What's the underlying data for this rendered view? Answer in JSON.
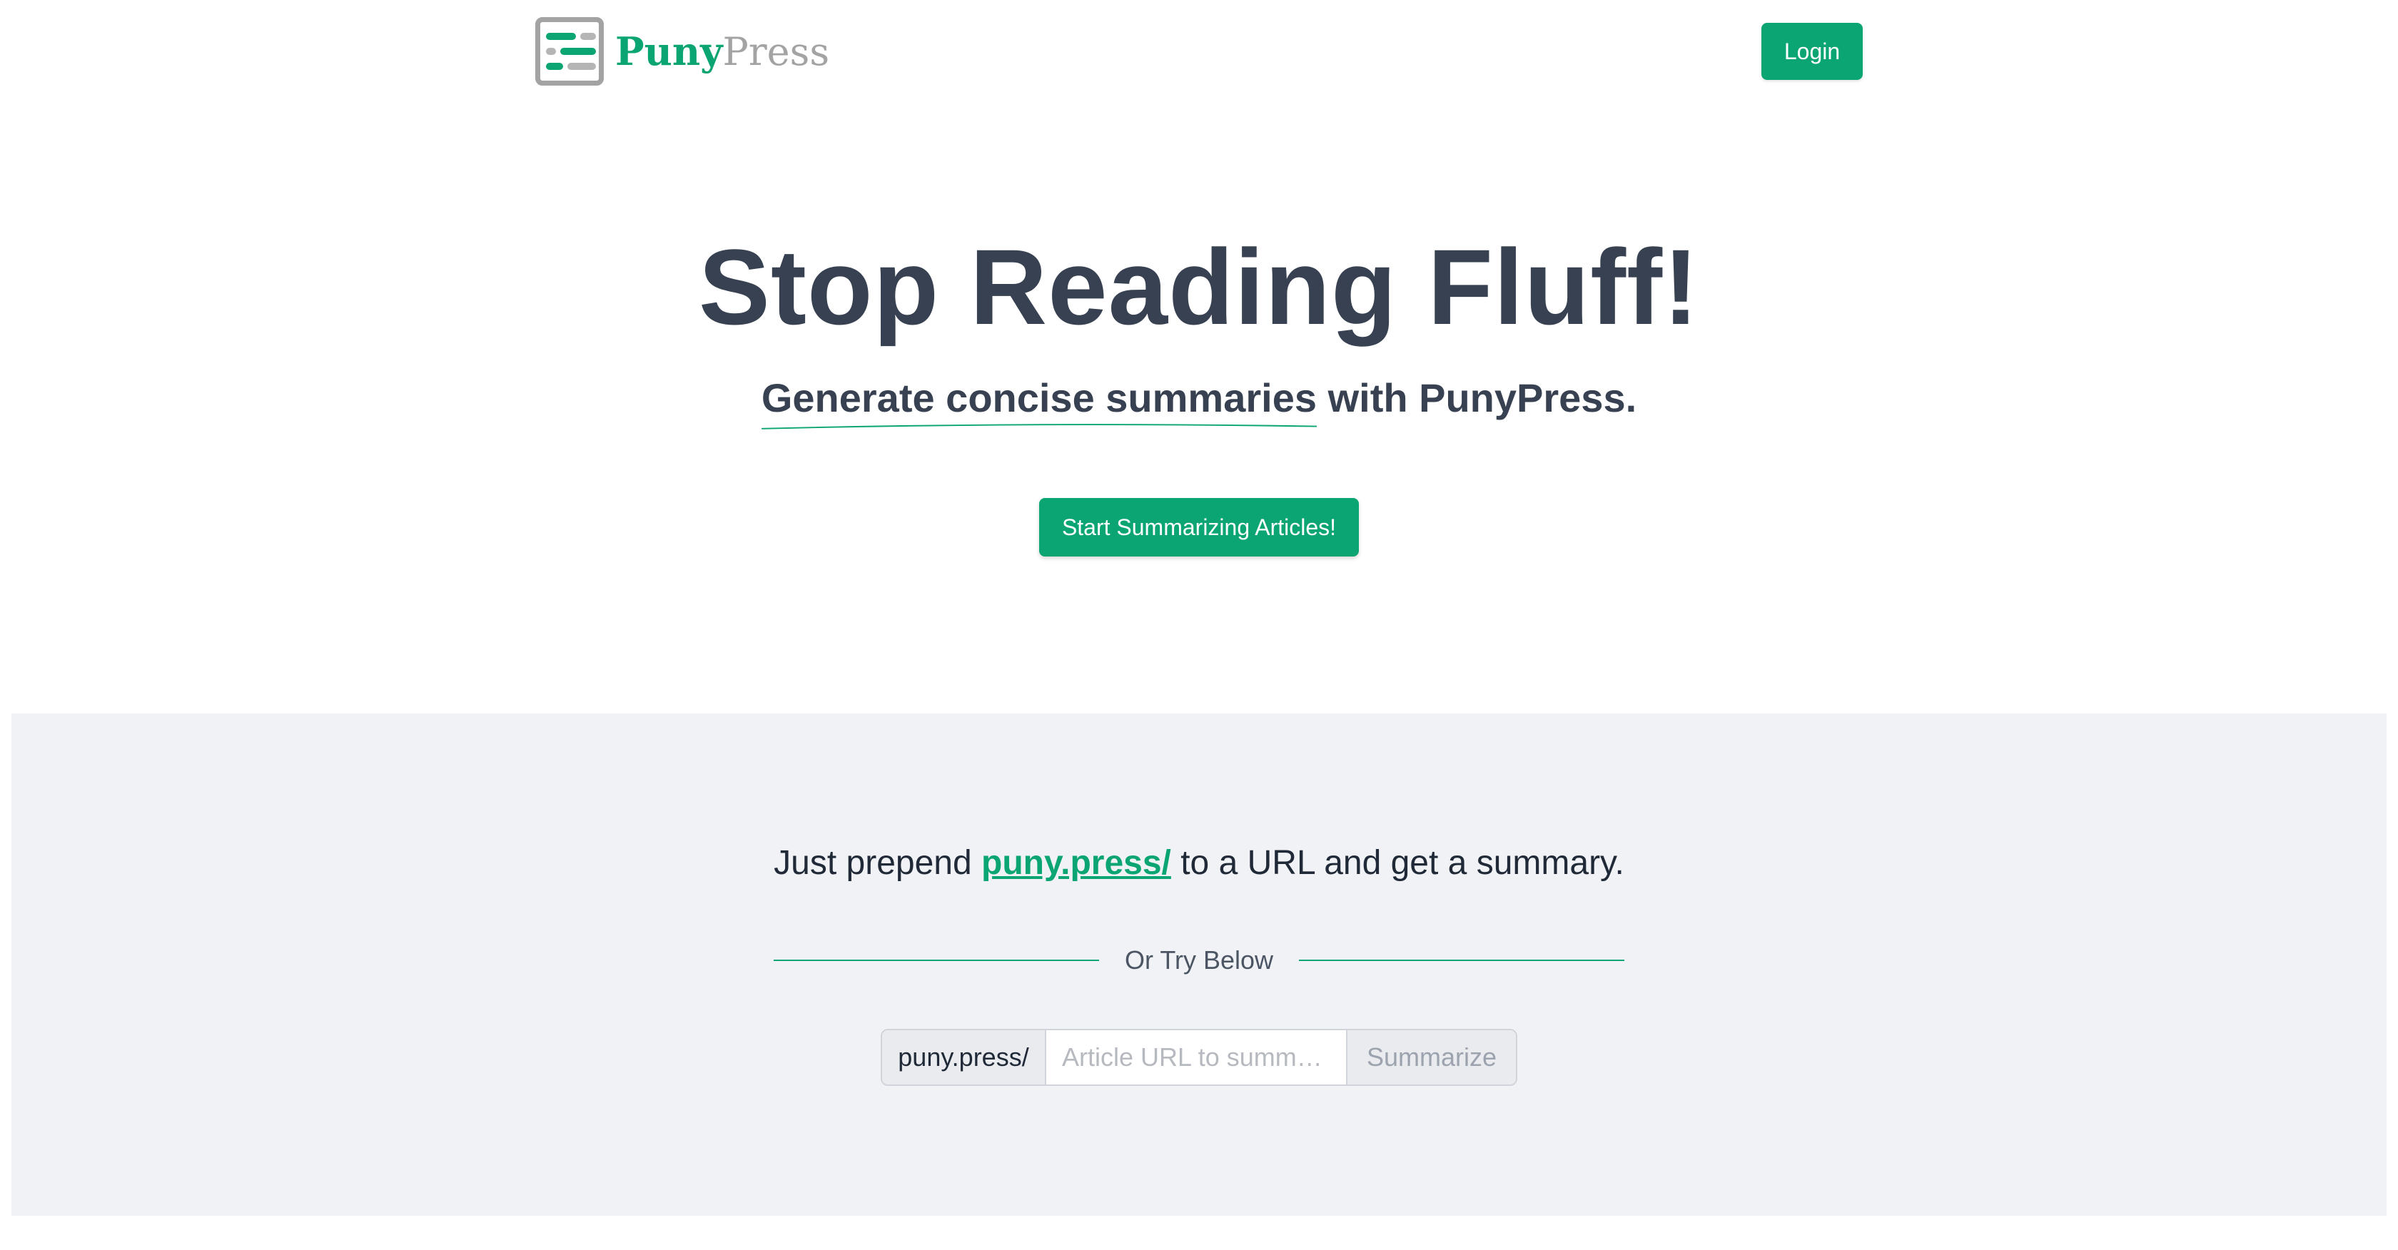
{
  "brand": {
    "name_puny": "Puny",
    "name_press": "Press"
  },
  "header": {
    "login_label": "Login"
  },
  "hero": {
    "title": "Stop Reading Fluff!",
    "subtitle_highlight": "Generate concise summaries",
    "subtitle_rest": " with PunyPress.",
    "cta_label": "Start Summarizing Articles!"
  },
  "try_section": {
    "prepend_before": "Just prepend ",
    "prepend_link": "puny.press/",
    "prepend_after": " to a URL and get a summary.",
    "divider_label": "Or Try Below",
    "form": {
      "prefix": "puny.press/",
      "input_placeholder": "Article URL to summ…",
      "input_value": "",
      "submit_label": "Summarize"
    }
  },
  "colors": {
    "accent": "#0aa572",
    "heading": "#374151",
    "section_bg": "#f0f2f5",
    "logo_gray": "#a3a3a3"
  },
  "icons": {
    "logo": "document-lines-icon"
  }
}
